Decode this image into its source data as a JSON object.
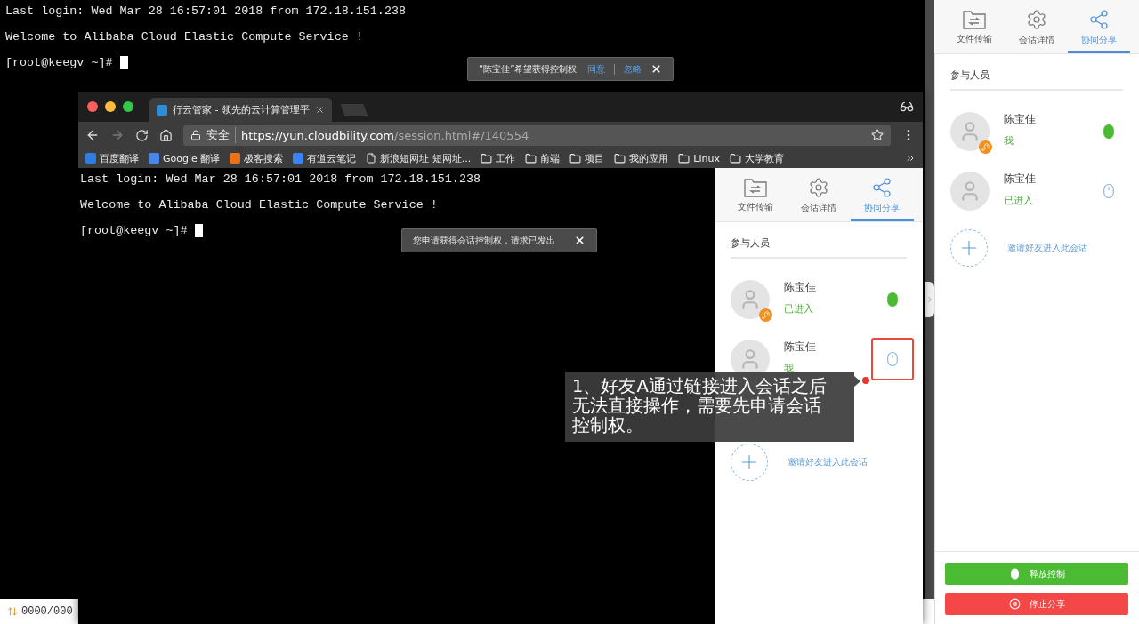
{
  "outer_terminal": {
    "lines": [
      "Last login: Wed Mar 28 16:57:01 2018 from 172.18.151.238",
      "Welcome to Alibaba Cloud Elastic Compute Service !"
    ],
    "prompt": "[root@keegv ~]#"
  },
  "notification": {
    "message": "“陈宝佳”希望获得控制权",
    "actions": [
      "同意",
      "忽略"
    ]
  },
  "status_bar": {
    "transfer": "0000/000"
  },
  "side_panel": {
    "tabs": [
      {
        "label": "文件传输",
        "kind": "files",
        "selected": false
      },
      {
        "label": "会话详情",
        "kind": "details",
        "selected": false
      },
      {
        "label": "协同分享",
        "kind": "share",
        "selected": true
      }
    ],
    "section_title": "参与人员",
    "participants": [
      {
        "name": "陈宝佳",
        "status": "我",
        "owner": true,
        "in_control": true,
        "highlighted": false
      },
      {
        "name": "陈宝佳",
        "status": "已进入",
        "owner": false,
        "in_control": false,
        "highlighted": false
      }
    ],
    "invite": "邀请好友进入此会话",
    "buttons": [
      {
        "label": "释放控制",
        "kind": "release"
      },
      {
        "label": "停止分享",
        "kind": "stop"
      }
    ]
  },
  "browser": {
    "tab_title": "行云管家 - 领先的云计算管理平",
    "security": "安全",
    "url_host": "https://yun.cloudbility.com",
    "url_path": "/session.html#/140554",
    "bookmarks": [
      {
        "label": "百度翻译",
        "kind": "site",
        "color": "#2f7de1"
      },
      {
        "label": "Google 翻译",
        "kind": "site",
        "color": "#4a86e8"
      },
      {
        "label": "极客搜索",
        "kind": "site",
        "color": "#e8731b"
      },
      {
        "label": "有道云笔记",
        "kind": "site",
        "color": "#3b82f6"
      },
      {
        "label": "新浪短网址 短网址...",
        "kind": "page"
      },
      {
        "label": "工作",
        "kind": "folder"
      },
      {
        "label": "前端",
        "kind": "folder"
      },
      {
        "label": "项目",
        "kind": "folder"
      },
      {
        "label": "我的应用",
        "kind": "folder"
      },
      {
        "label": "Linux",
        "kind": "folder"
      },
      {
        "label": "大学教育",
        "kind": "folder"
      }
    ],
    "terminal": {
      "lines": [
        "Last login: Wed Mar 28 16:57:01 2018 from 172.18.151.238",
        "Welcome to Alibaba Cloud Elastic Compute Service !"
      ],
      "prompt": "[root@keegv ~]#"
    },
    "notification": {
      "message": "您申请获得会话控制权，请求已发出"
    },
    "side_panel": {
      "tabs": [
        {
          "label": "文件传输",
          "kind": "files",
          "selected": false
        },
        {
          "label": "会话详情",
          "kind": "details",
          "selected": false
        },
        {
          "label": "协同分享",
          "kind": "share",
          "selected": true
        }
      ],
      "section_title": "参与人员",
      "participants": [
        {
          "name": "陈宝佳",
          "status": "已进入",
          "owner": true,
          "in_control": true,
          "highlighted": false
        },
        {
          "name": "陈宝佳",
          "status": "我",
          "owner": false,
          "in_control": false,
          "highlighted": true
        }
      ],
      "invite": "邀请好友进入此会话"
    }
  },
  "annotation": {
    "text": "1、好友A通过链接进入会话之后无法直接操作，需要先申请会话控制权。"
  }
}
